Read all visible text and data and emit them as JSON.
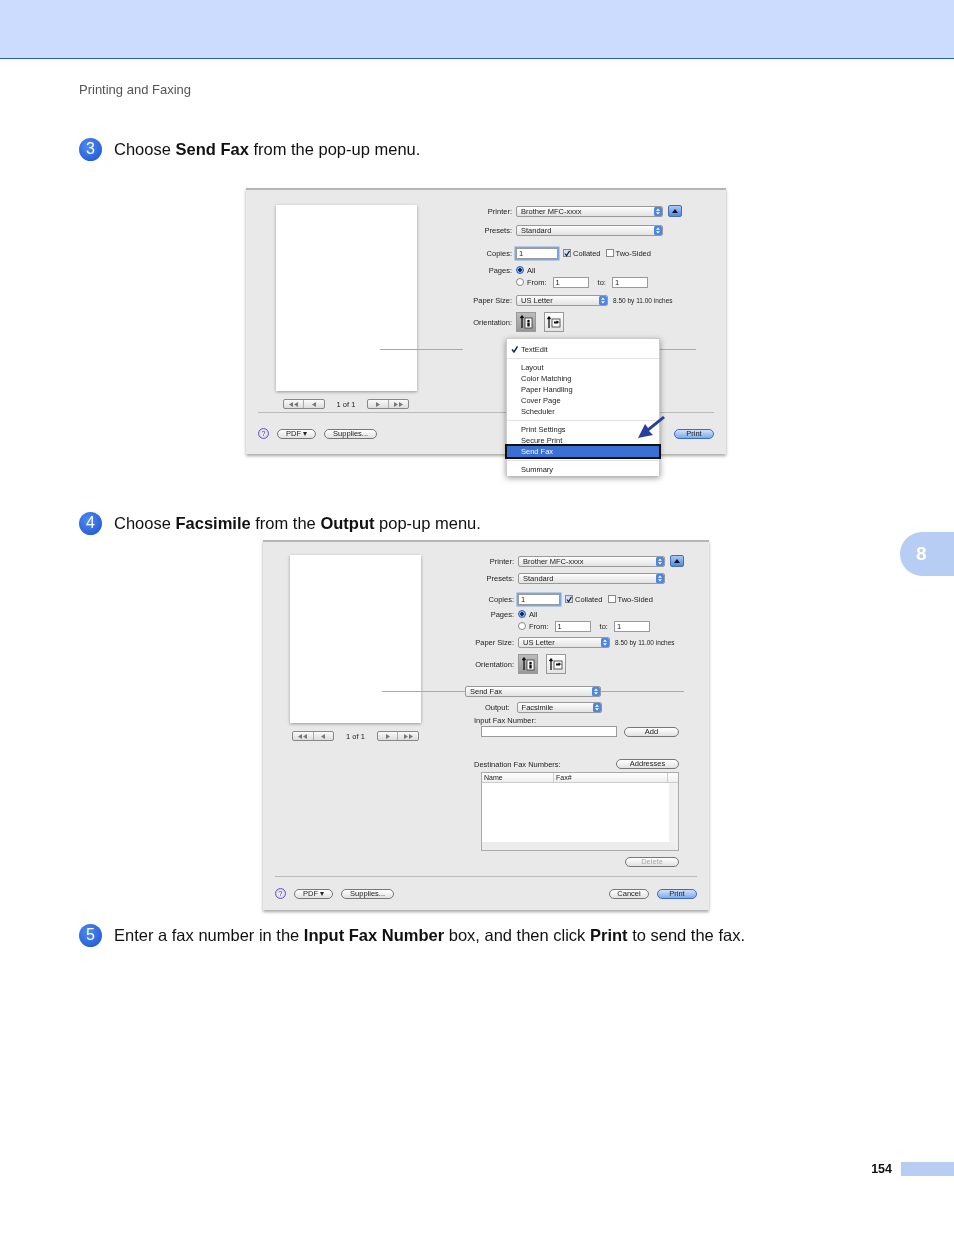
{
  "header": {
    "section": "Printing and Faxing"
  },
  "steps": [
    {
      "number": "3",
      "text": "Choose **Send Fax** from the pop-up menu."
    },
    {
      "number": "4",
      "text": "Choose **Facsimile** from the **Output** pop-up menu."
    },
    {
      "number": "5",
      "text": "Enter a fax number in the **Input Fax Number** box, and then click **Print** to send the fax."
    }
  ],
  "dialogs": [
    {
      "printer": {
        "label": "Printer:",
        "value": "Brother MFC-xxxx"
      },
      "presets": {
        "label": "Presets:",
        "value": "Standard"
      },
      "copies": {
        "label": "Copies:",
        "value": "1"
      },
      "collated": {
        "label": "Collated",
        "checked": true
      },
      "two_sided": {
        "label": "Two-Sided",
        "checked": false
      },
      "pages": {
        "label": "Pages:",
        "options": [
          {
            "label": "All",
            "selected": true
          },
          {
            "label": "From:",
            "selected": false
          }
        ],
        "from": "1",
        "to_label": "to:",
        "to": "1"
      },
      "paper_size": {
        "label": "Paper Size:",
        "value": "US Letter",
        "dimensions": "8.50 by 11.00 inches"
      },
      "orientation": {
        "label": "Orientation:",
        "options": [
          {
            "kind": "portrait",
            "selected": true
          },
          {
            "kind": "landscape",
            "selected": false
          }
        ]
      },
      "page_indicator": "1 of 1",
      "help": "?",
      "buttons": [
        "PDF ▾",
        "Supplies..."
      ],
      "actions": [
        {
          "label": "Print",
          "default": true
        }
      ],
      "menu": {
        "groups": [
          [
            {
              "label": "TextEdit",
              "checked": true,
              "selected": false
            }
          ],
          [
            {
              "label": "Layout",
              "checked": false,
              "selected": false
            },
            {
              "label": "Color Matching",
              "checked": false,
              "selected": false
            },
            {
              "label": "Paper Handling",
              "checked": false,
              "selected": false
            },
            {
              "label": "Cover Page",
              "checked": false,
              "selected": false
            },
            {
              "label": "Scheduler",
              "checked": false,
              "selected": false
            }
          ],
          [
            {
              "label": "Print Settings",
              "checked": false,
              "selected": false
            },
            {
              "label": "Secure Print",
              "checked": false,
              "selected": false
            },
            {
              "label": "Send Fax",
              "checked": false,
              "selected": true
            }
          ],
          [
            {
              "label": "Summary",
              "checked": false,
              "selected": false
            }
          ]
        ]
      }
    },
    {
      "printer": {
        "label": "Printer:",
        "value": "Brother MFC-xxxx"
      },
      "presets": {
        "label": "Presets:",
        "value": "Standard"
      },
      "copies": {
        "label": "Copies:",
        "value": "1"
      },
      "collated": {
        "label": "Collated",
        "checked": true
      },
      "two_sided": {
        "label": "Two-Sided",
        "checked": false
      },
      "pages": {
        "label": "Pages:",
        "options": [
          {
            "label": "All",
            "selected": true
          },
          {
            "label": "From:",
            "selected": false
          }
        ],
        "from": "1",
        "to_label": "to:",
        "to": "1"
      },
      "paper_size": {
        "label": "Paper Size:",
        "value": "US Letter",
        "dimensions": "8.50 by 11.00 inches"
      },
      "orientation": {
        "label": "Orientation:",
        "options": [
          {
            "kind": "portrait",
            "selected": true
          },
          {
            "kind": "landscape",
            "selected": false
          }
        ]
      },
      "page_indicator": "1 of 1",
      "help": "?",
      "buttons": [
        "PDF ▾",
        "Supplies..."
      ],
      "actions": [
        {
          "label": "Cancel",
          "default": false
        },
        {
          "label": "Print",
          "default": true
        }
      ],
      "pane": "Send Fax",
      "fax": {
        "output_label": "Output:",
        "output_value": "Facsimile",
        "input_label": "Input Fax Number:",
        "add_button": "Add",
        "destination_label": "Destination Fax Numbers:",
        "addresses_button": "Addresses",
        "columns": [
          "Name",
          "Fax#"
        ],
        "delete": {
          "label": "Delete",
          "disabled": true
        }
      }
    }
  ],
  "chapter_tab": "8",
  "page_number": "154"
}
